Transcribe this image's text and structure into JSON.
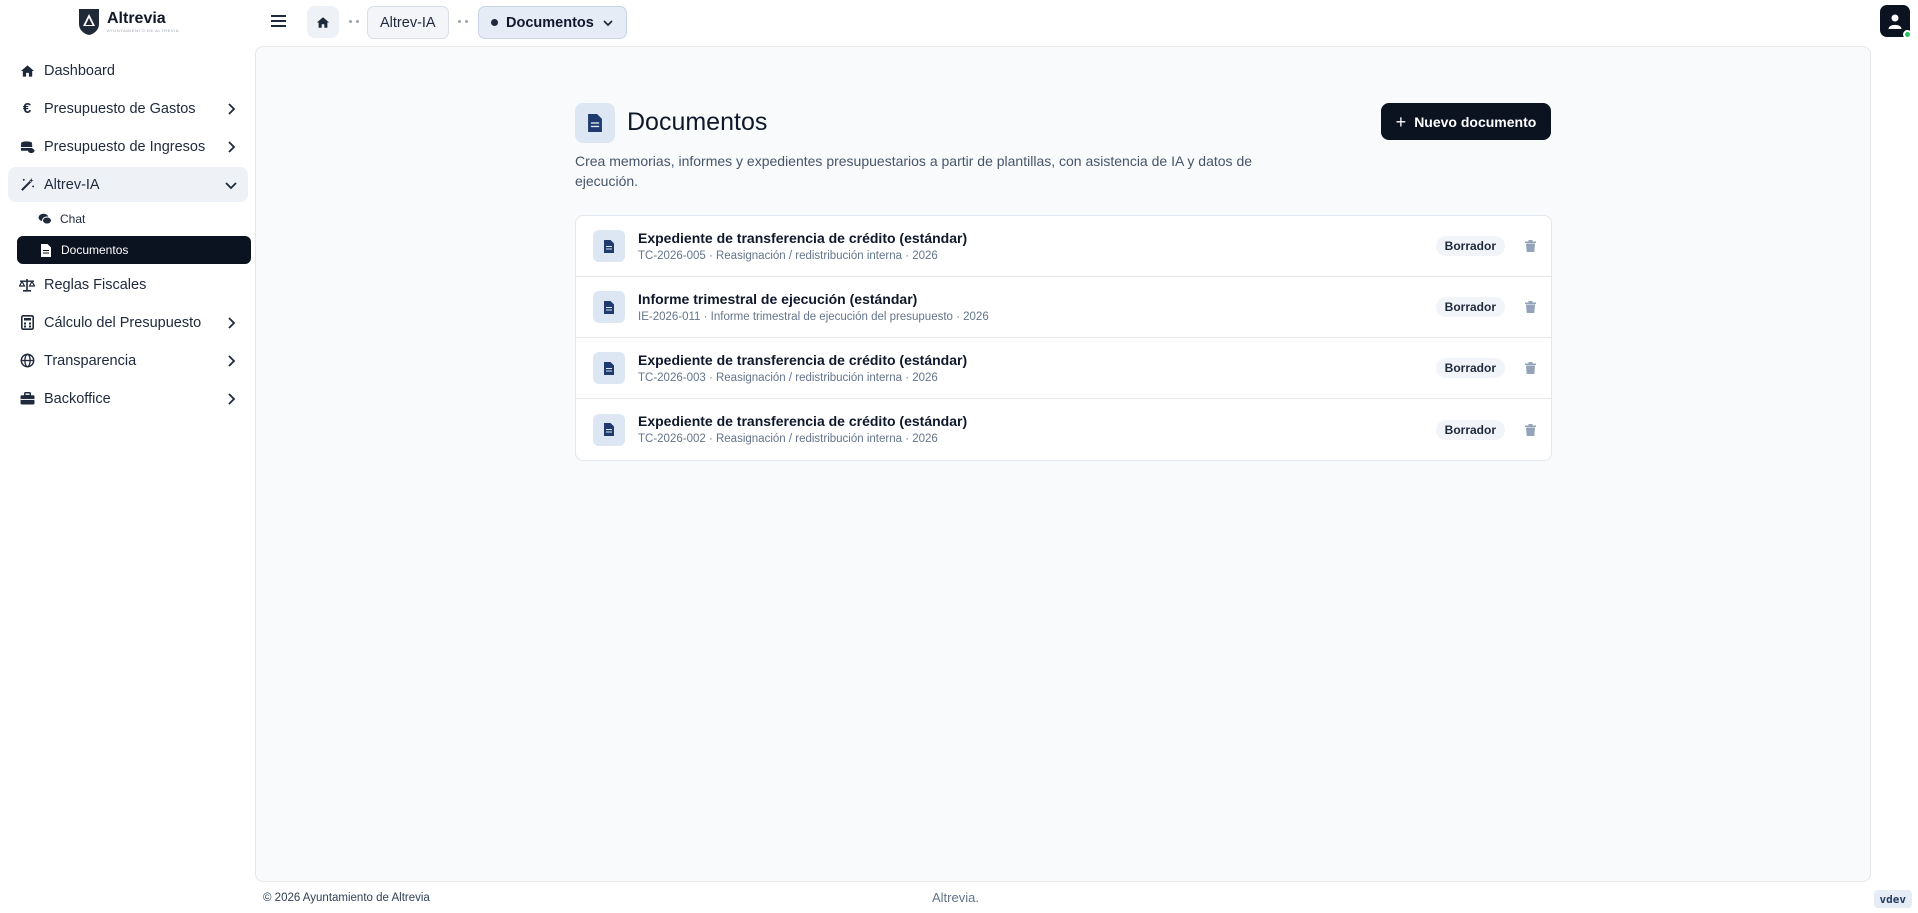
{
  "brand": {
    "name": "Altrevia",
    "subtitle": "AYUNTAMIENTO DE ALTREVIA"
  },
  "sidebar": {
    "items": [
      {
        "label": "Dashboard",
        "icon": "home-icon",
        "has_children": false
      },
      {
        "label": "Presupuesto de Gastos",
        "icon": "euro-icon",
        "has_children": true
      },
      {
        "label": "Presupuesto de Ingresos",
        "icon": "coins-icon",
        "has_children": true
      },
      {
        "label": "Altrev-IA",
        "icon": "magic-wand-icon",
        "has_children": true,
        "expanded": true,
        "children": [
          {
            "label": "Chat",
            "icon": "chat-bubbles-icon"
          },
          {
            "label": "Documentos",
            "icon": "document-icon",
            "active": true
          }
        ]
      },
      {
        "label": "Reglas Fiscales",
        "icon": "scale-icon",
        "has_children": false
      },
      {
        "label": "Cálculo del Presupuesto",
        "icon": "calculator-icon",
        "has_children": true
      },
      {
        "label": "Transparencia",
        "icon": "globe-icon",
        "has_children": true
      },
      {
        "label": "Backoffice",
        "icon": "briefcase-icon",
        "has_children": true
      }
    ]
  },
  "breadcrumb": {
    "home_icon": "home-icon",
    "items": [
      {
        "label": "Altrev-IA"
      },
      {
        "label": "Documentos",
        "current": true
      }
    ]
  },
  "page": {
    "title": "Documentos",
    "description": "Crea memorias, informes y expedientes presupuestarios a partir de plantillas, con asistencia de IA y datos de ejecución.",
    "new_button_label": "Nuevo documento"
  },
  "documents": [
    {
      "title": "Expediente de transferencia de crédito (estándar)",
      "meta": "TC-2026-005 · Reasignación / redistribución interna · 2026",
      "status": "Borrador"
    },
    {
      "title": "Informe trimestral de ejecución (estándar)",
      "meta": "IE-2026-011 · Informe trimestral de ejecución del presupuesto · 2026",
      "status": "Borrador"
    },
    {
      "title": "Expediente de transferencia de crédito (estándar)",
      "meta": "TC-2026-003 · Reasignación / redistribución interna · 2026",
      "status": "Borrador"
    },
    {
      "title": "Expediente de transferencia de crédito (estándar)",
      "meta": "TC-2026-002 · Reasignación / redistribución interna · 2026",
      "status": "Borrador"
    }
  ],
  "footer": {
    "copyright": "© 2026 Ayuntamiento de Altrevia",
    "center": "Altrevia.",
    "version": "vdev"
  },
  "colors": {
    "primary_dark": "#0b1220",
    "accent_light": "#dde6f3",
    "background": "#f8fafc"
  }
}
